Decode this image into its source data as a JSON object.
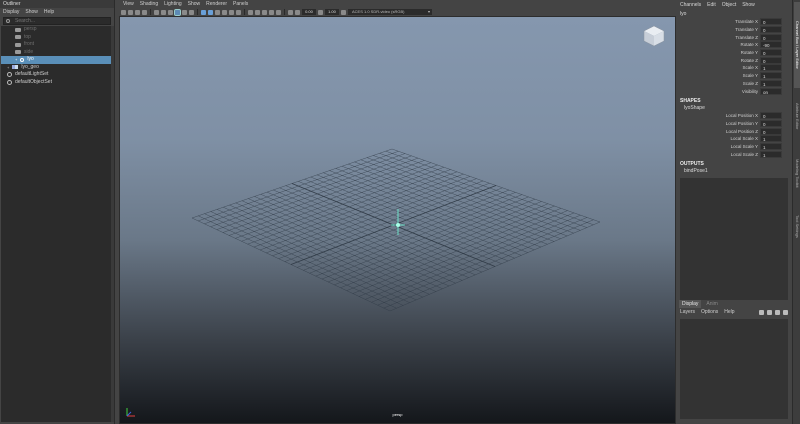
{
  "outliner": {
    "title": "Outliner",
    "menu": [
      "Display",
      "Show",
      "Help"
    ],
    "search_placeholder": "Search...",
    "items": [
      {
        "label": "persp",
        "icon": "camera-icon",
        "dim": true
      },
      {
        "label": "top",
        "icon": "camera-icon",
        "dim": true
      },
      {
        "label": "front",
        "icon": "camera-icon",
        "dim": true
      },
      {
        "label": "side",
        "icon": "camera-icon",
        "dim": true
      },
      {
        "label": "lyo",
        "icon": "joint-icon",
        "selected": true
      },
      {
        "label": "lyo_geo",
        "icon": "geometry-icon"
      },
      {
        "label": "defaultLightSet",
        "icon": "set-icon"
      },
      {
        "label": "defaultObjectSet",
        "icon": "set-icon"
      }
    ]
  },
  "viewport": {
    "menu": [
      "View",
      "Shading",
      "Lighting",
      "Show",
      "Renderer",
      "Panels"
    ],
    "field_near": "0.00",
    "field_gamma": "1.00",
    "color_space": "ACES 1.0 SDR-video (sRGB)",
    "camera_label": "persp",
    "colors": {
      "sky_top": "#8597ae",
      "ground_bottom": "#14171b",
      "grid": "#2f3a46",
      "selection": "#5a8fb8"
    }
  },
  "channel_box": {
    "menu": [
      "Channels",
      "Edit",
      "Object",
      "Show"
    ],
    "object_name": "lyo",
    "attributes": [
      {
        "label": "Translate X",
        "value": "0"
      },
      {
        "label": "Translate Y",
        "value": "0"
      },
      {
        "label": "Translate Z",
        "value": "0"
      },
      {
        "label": "Rotate X",
        "value": "-90"
      },
      {
        "label": "Rotate Y",
        "value": "0"
      },
      {
        "label": "Rotate Z",
        "value": "0"
      },
      {
        "label": "Scale X",
        "value": "1"
      },
      {
        "label": "Scale Y",
        "value": "1"
      },
      {
        "label": "Scale Z",
        "value": "1"
      },
      {
        "label": "Visibility",
        "value": "on"
      }
    ],
    "shapes_header": "SHAPES",
    "shape_name": "lyoShape",
    "shape_attributes": [
      {
        "label": "Local Position X",
        "value": "0"
      },
      {
        "label": "Local Position Y",
        "value": "0"
      },
      {
        "label": "Local Position Z",
        "value": "0"
      },
      {
        "label": "Local Scale X",
        "value": "1"
      },
      {
        "label": "Local Scale Y",
        "value": "1"
      },
      {
        "label": "Local Scale Z",
        "value": "1"
      }
    ],
    "outputs_header": "OUTPUTS",
    "output_name": "bindPose1"
  },
  "layer_editor": {
    "tabs": [
      "Display",
      "Anim"
    ],
    "menu": [
      "Layers",
      "Options",
      "Help"
    ]
  },
  "side_tabs": [
    "Channel Box / Layer Editor",
    "Attribute Editor",
    "Modeling Toolkit",
    "Tool Settings"
  ]
}
